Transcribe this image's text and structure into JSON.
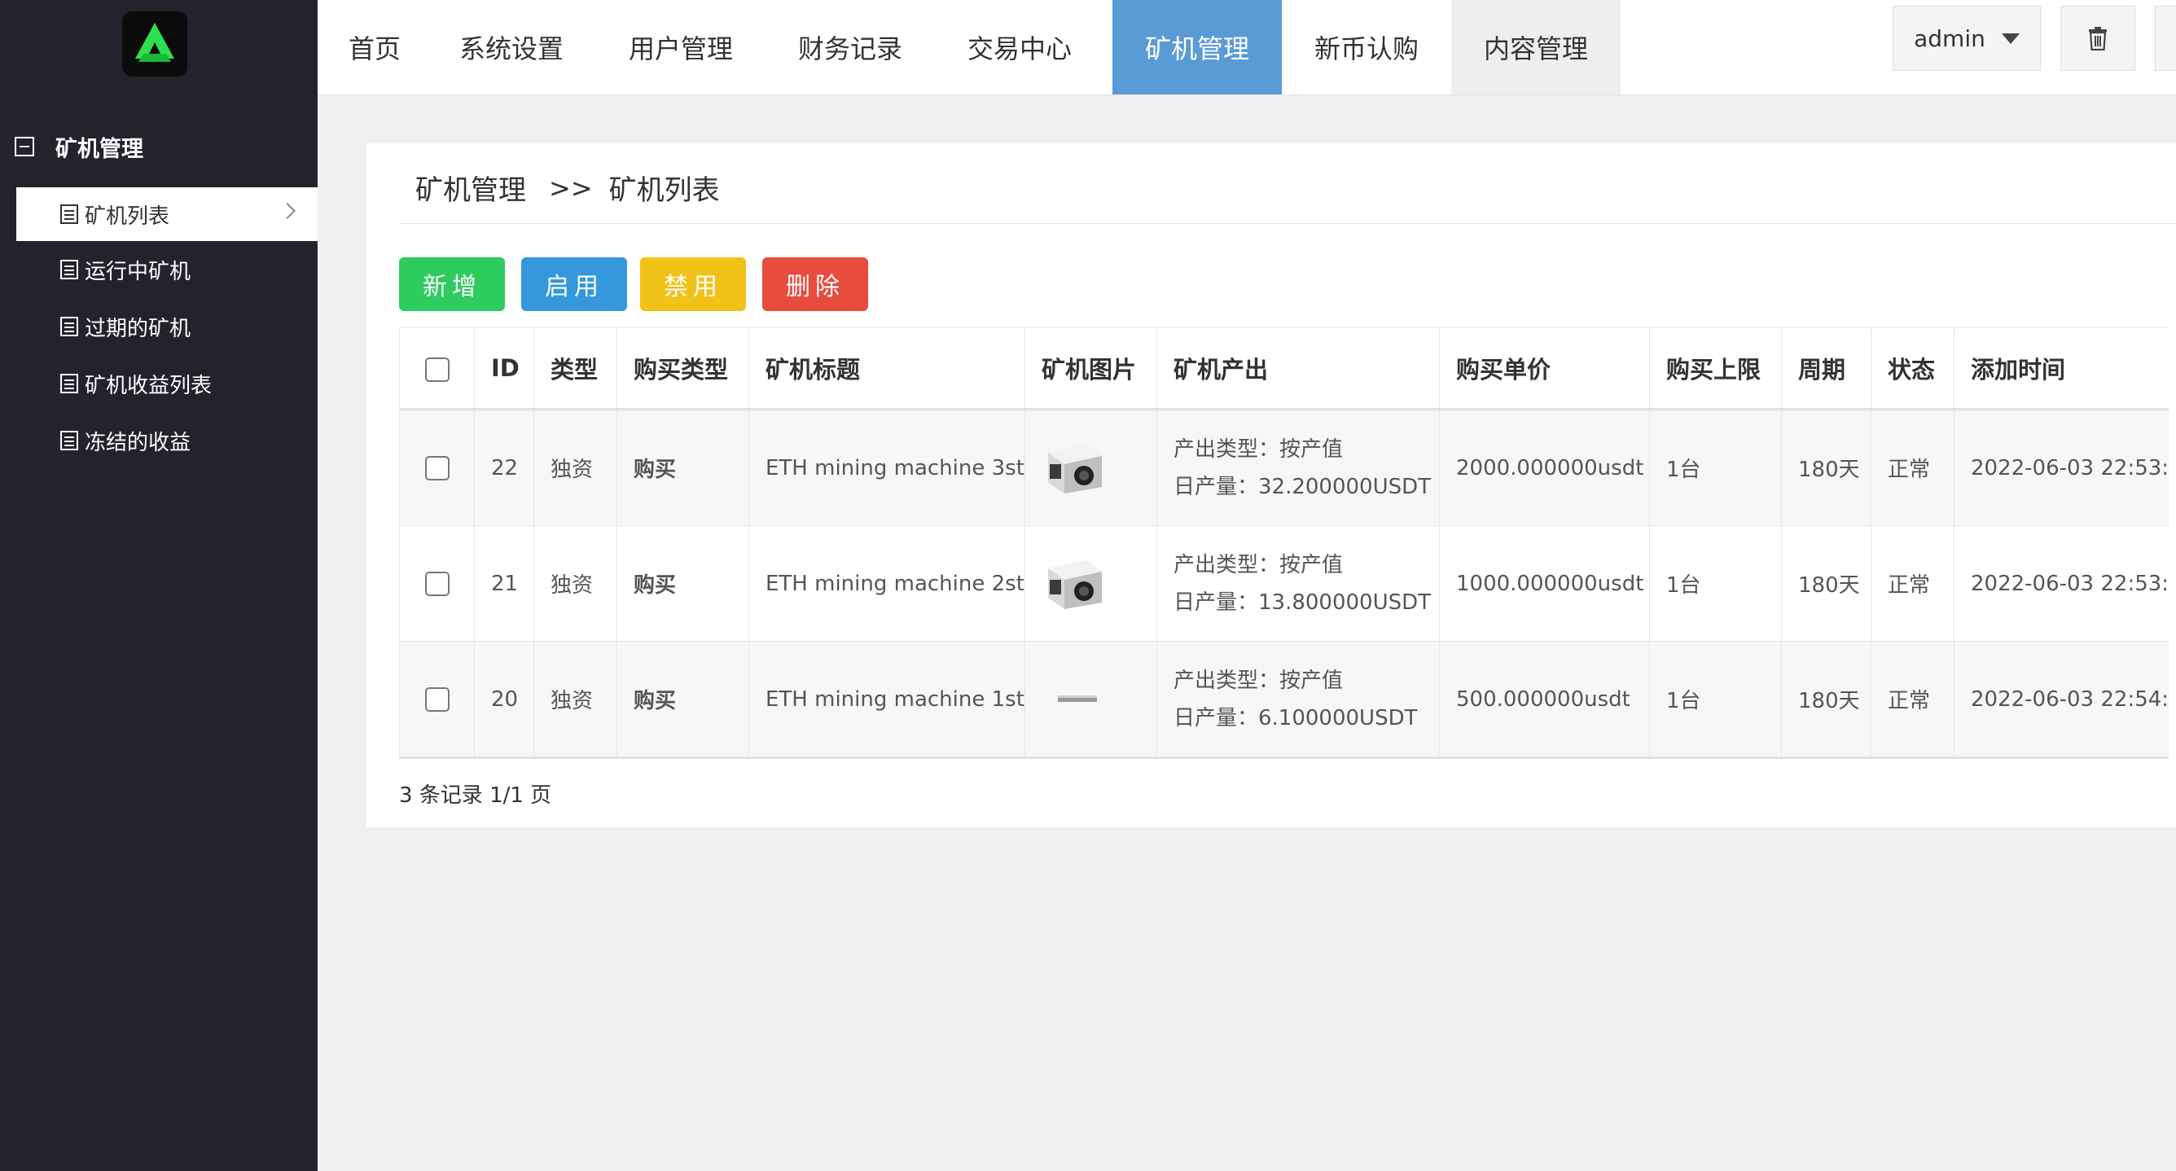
{
  "sidebar": {
    "section_title": "矿机管理",
    "items": [
      {
        "label": "矿机列表",
        "active": true
      },
      {
        "label": "运行中矿机",
        "active": false
      },
      {
        "label": "过期的矿机",
        "active": false
      },
      {
        "label": "矿机收益列表",
        "active": false
      },
      {
        "label": "冻结的收益",
        "active": false
      }
    ]
  },
  "topnav": {
    "tabs": [
      {
        "label": "首页"
      },
      {
        "label": "系统设置"
      },
      {
        "label": "用户管理"
      },
      {
        "label": "财务记录"
      },
      {
        "label": "交易中心"
      },
      {
        "label": "矿机管理",
        "active": true
      },
      {
        "label": "新币认购"
      },
      {
        "label": "内容管理",
        "hover": true
      }
    ],
    "user": "admin",
    "trash_icon": "trash-icon"
  },
  "breadcrumb": {
    "parent": "矿机管理",
    "separator": ">>",
    "current": "矿机列表"
  },
  "actions": {
    "add": "新增",
    "enable": "启用",
    "disable": "禁用",
    "delete": "删除"
  },
  "colors": {
    "sidebar_bg": "#23232e",
    "active_tab": "#5b9bd5",
    "add": "#2ecc5f",
    "enable": "#3498db",
    "disable": "#f2c218",
    "delete": "#e74c3c",
    "buy_text": "#28a745"
  },
  "table": {
    "headers": [
      "ID",
      "类型",
      "购买类型",
      "矿机标题",
      "矿机图片",
      "矿机产出",
      "购买单价",
      "购买上限",
      "周期",
      "状态",
      "添加时间"
    ],
    "rows": [
      {
        "id": "22",
        "type": "独资",
        "buy_type": "购买",
        "title": "ETH mining machine 3st",
        "output_type": "产出类型：按产值",
        "daily_output": "日产量：32.200000USDT",
        "price": "2000.000000usdt",
        "limit": "1台",
        "period": "180天",
        "status": "正常",
        "added": "2022-06-03 22:53:"
      },
      {
        "id": "21",
        "type": "独资",
        "buy_type": "购买",
        "title": "ETH mining machine 2st",
        "output_type": "产出类型：按产值",
        "daily_output": "日产量：13.800000USDT",
        "price": "1000.000000usdt",
        "limit": "1台",
        "period": "180天",
        "status": "正常",
        "added": "2022-06-03 22:53:"
      },
      {
        "id": "20",
        "type": "独资",
        "buy_type": "购买",
        "title": "ETH mining machine 1st",
        "output_type": "产出类型：按产值",
        "daily_output": "日产量：6.100000USDT",
        "price": "500.000000usdt",
        "limit": "1台",
        "period": "180天",
        "status": "正常",
        "added": "2022-06-03 22:54:"
      }
    ],
    "footer": "3 条记录 1/1 页"
  }
}
